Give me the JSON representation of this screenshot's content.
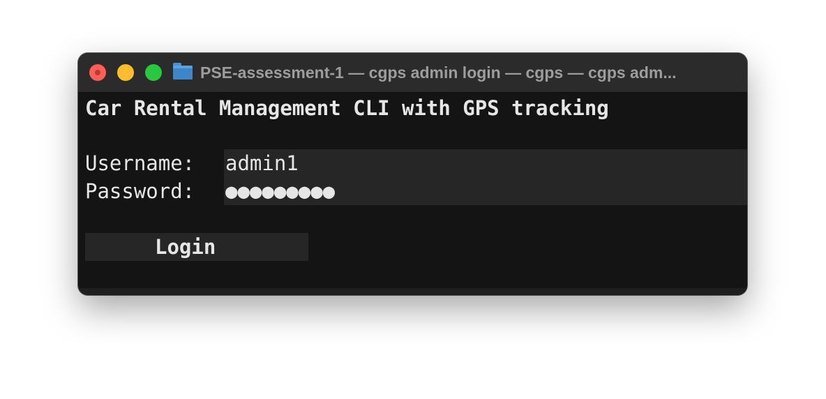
{
  "window": {
    "title": "PSE-assessment-1 — cgps admin login — cgps — cgps adm...",
    "folder_icon": "folder-icon"
  },
  "traffic_lights": {
    "close": "#ff5f57",
    "minimize": "#febc2e",
    "maximize": "#28c840"
  },
  "terminal": {
    "heading": "Car Rental Management CLI with GPS tracking",
    "username_label": "Username: ",
    "username_value": "admin1",
    "password_label": "Password: ",
    "password_value": "●●●●●●●●●",
    "login_label": "Login"
  },
  "colors": {
    "terminal_bg": "#141414",
    "field_bg": "#262626",
    "text": "#e6e6e6"
  }
}
